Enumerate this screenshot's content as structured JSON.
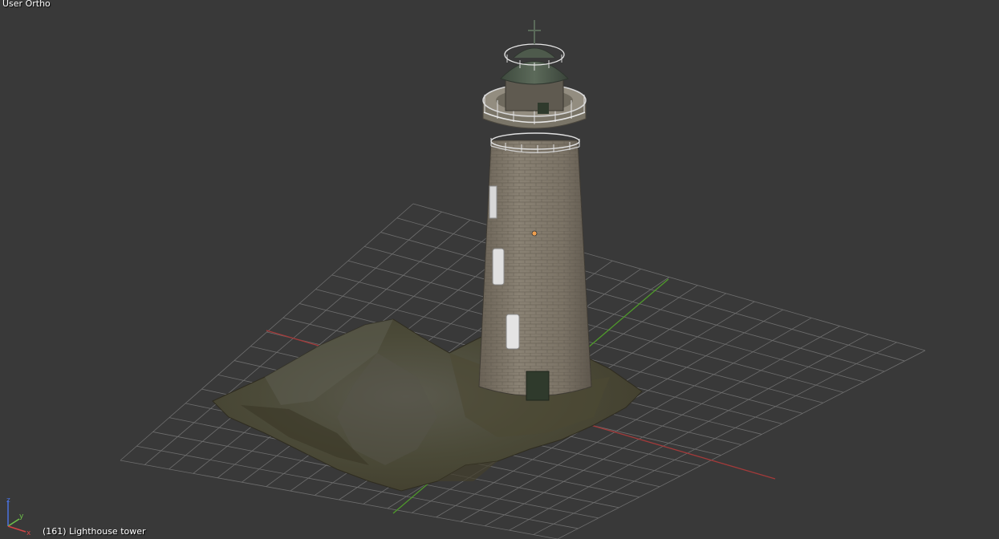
{
  "viewport": {
    "view_label": "User Ortho",
    "object_info": "(161) Lighthouse tower",
    "background_color": "#393939",
    "grid_color": "#6e6e6e",
    "x_axis_color": "#a23a3a",
    "y_axis_color": "#4f9a2b"
  },
  "gizmo": {
    "x_label": "x",
    "y_label": "y",
    "z_label": "z",
    "x_color": "#d24545",
    "y_color": "#6fc24a",
    "z_color": "#4a72e0"
  },
  "scene_object": {
    "name": "Lighthouse tower",
    "type": "lighthouse-model"
  }
}
